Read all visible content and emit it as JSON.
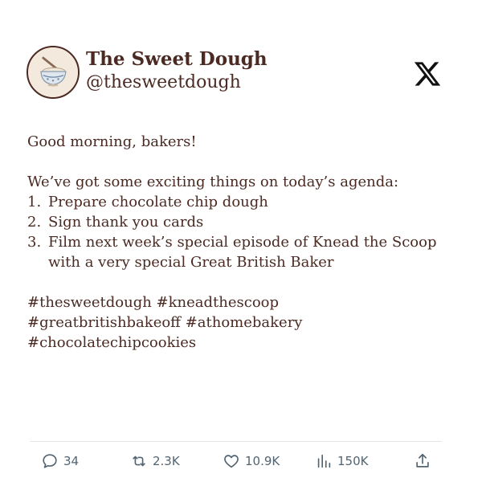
{
  "profile": {
    "display_name": "The Sweet Dough",
    "handle": "@thesweetdough",
    "avatar_icon": "mixing-bowl-illustration",
    "platform_icon": "x-logo-icon"
  },
  "post": {
    "greeting": "Good morning, bakers!",
    "intro": "We’ve got some exciting things on today’s agenda:",
    "agenda": [
      {
        "num": "1.",
        "text": "Prepare chocolate chip dough"
      },
      {
        "num": "2.",
        "text": "Sign thank you cards"
      },
      {
        "num": "3.",
        "text": "Film next week’s special episode of Knead the Scoop with a very special Great British Baker"
      }
    ],
    "hashtags_line1": "#thesweetdough #kneadthescoop",
    "hashtags_line2": "#greatbritishbakeoff #athomebakery",
    "hashtags_line3": "#chocolatechipcookies"
  },
  "actions": {
    "replies": "34",
    "reposts": "2.3K",
    "likes": "10.9K",
    "views": "150K"
  },
  "colors": {
    "text": "#4a2a22",
    "action_gray": "#536471",
    "divider": "#e6e6e6"
  }
}
